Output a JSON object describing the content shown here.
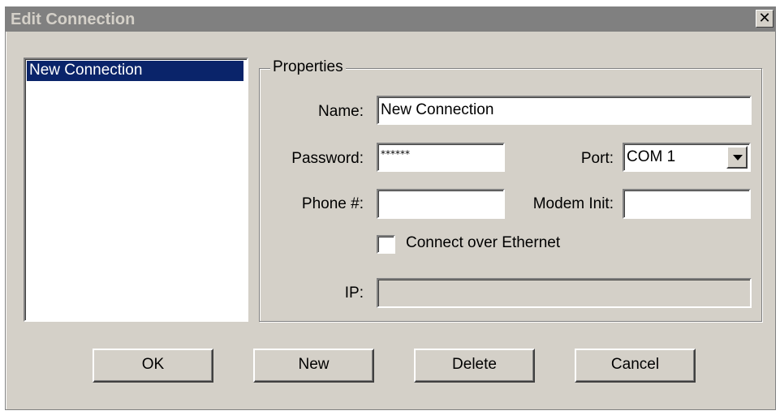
{
  "window": {
    "title": "Edit Connection",
    "close_glyph": "✕"
  },
  "connections": {
    "items": [
      {
        "label": "New Connection",
        "selected": true
      }
    ]
  },
  "properties": {
    "group_label": "Properties",
    "name": {
      "label": "Name:",
      "value": "New Connection"
    },
    "password": {
      "label": "Password:",
      "value": "******"
    },
    "port": {
      "label": "Port:",
      "value": "COM 1"
    },
    "phone": {
      "label": "Phone #:",
      "value": ""
    },
    "modem_init": {
      "label": "Modem Init:",
      "value": ""
    },
    "ethernet": {
      "label": "Connect over Ethernet",
      "checked": false
    },
    "ip": {
      "label": "IP:",
      "value": "",
      "enabled": false
    }
  },
  "buttons": {
    "ok": "OK",
    "new": "New",
    "delete": "Delete",
    "cancel": "Cancel"
  },
  "colors": {
    "selection": "#0a246a",
    "face": "#d4d0c8",
    "titlebar": "#808080"
  }
}
